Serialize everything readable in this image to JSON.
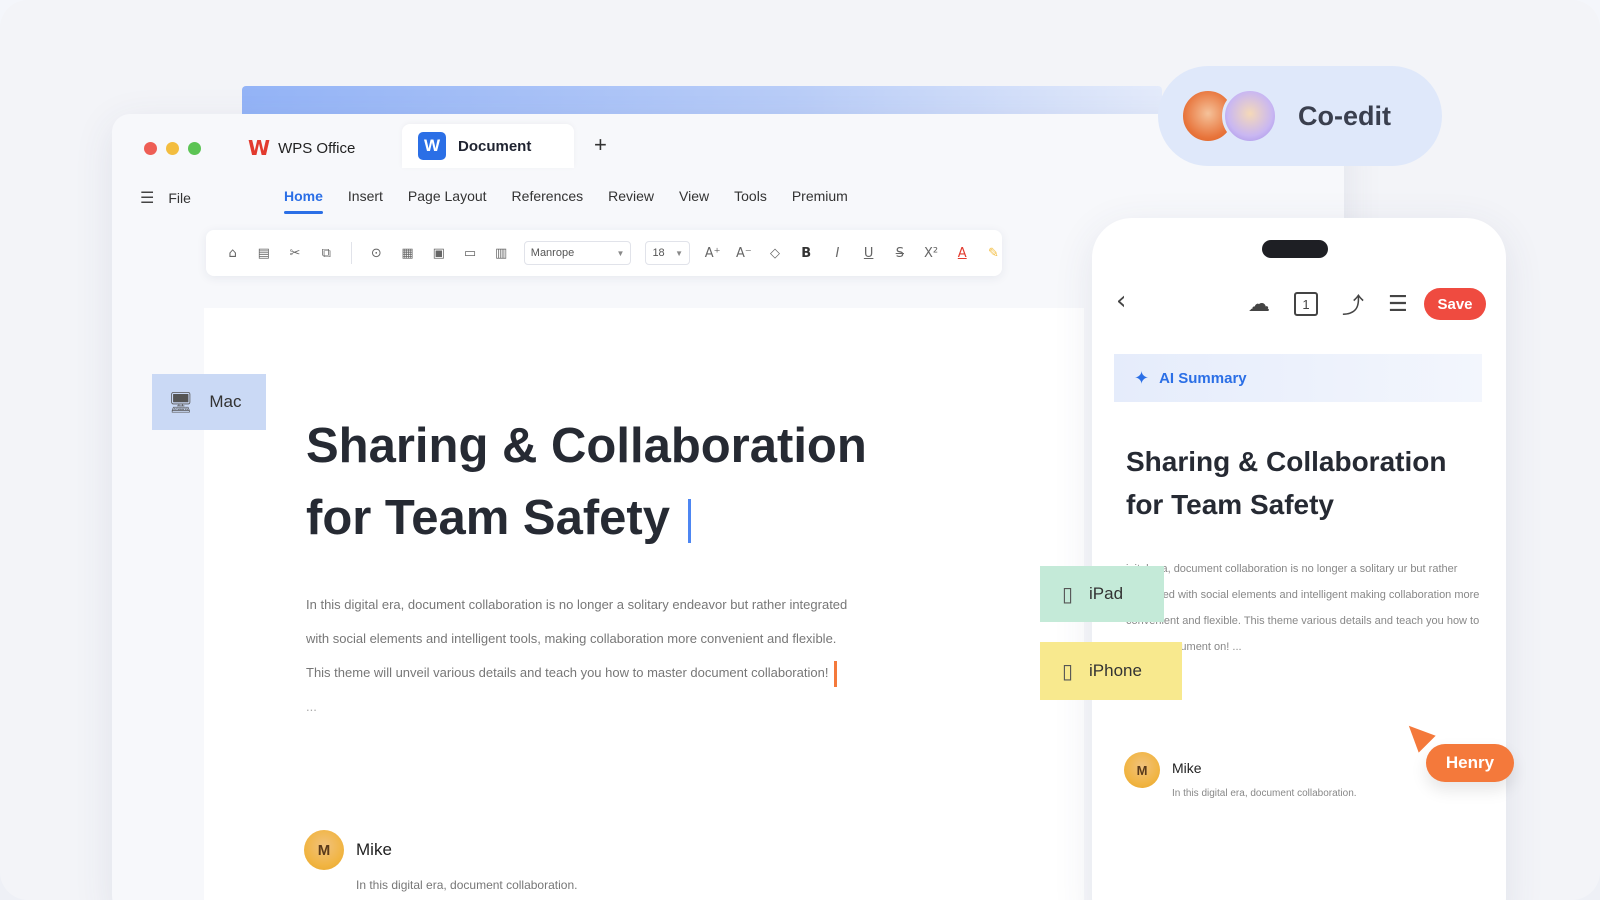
{
  "app": {
    "name": "WPS Office",
    "doc_tab": "Document",
    "new_tab": "+"
  },
  "menu": {
    "file": "File",
    "tabs": [
      "Home",
      "Insert",
      "Page Layout",
      "References",
      "Review",
      "View",
      "Tools",
      "Premium"
    ],
    "active_tab": "Home"
  },
  "toolbar": {
    "font": "Manrope",
    "size": "18"
  },
  "document": {
    "title_line1": "Sharing & Collaboration",
    "title_line2": "for Team Safety",
    "body_line1": "In this digital era, document collaboration is no longer a solitary endeavor but rather integrated",
    "body_line2": "with social elements and intelligent tools, making collaboration more convenient and flexible.",
    "body_line3": "This theme will unveil various details and teach you how to master document collaboration!",
    "ellipsis": "...",
    "comment": {
      "author": "Mike",
      "avatar": "M",
      "text": "In this digital era, document collaboration."
    }
  },
  "devices": {
    "mac": "Mac",
    "ipad": "iPad",
    "iphone": "iPhone"
  },
  "coedit": {
    "label": "Co-edit",
    "avatar1": "",
    "avatar2": ""
  },
  "phone": {
    "save": "Save",
    "page_num": "1",
    "ai_summary": "AI Summary",
    "title_line1": "Sharing & Collaboration",
    "title_line2": "for Team Safety",
    "body": "igital era, document collaboration is no longer a solitary   ur but rather integrated with social elements and intelligent   making collaboration more convenient and flexible. This theme   various details and teach you how to master document   on! ...",
    "comment": {
      "author": "Mike",
      "avatar": "M",
      "text": "In this digital era, document collaboration."
    }
  },
  "cursor_user": "Henry",
  "colors": {
    "accent": "#2b6fe6",
    "save": "#ef4b40",
    "henry": "#f4793b",
    "mac": "#cad9f5",
    "ipad": "#c4ead8",
    "iphone": "#f8e98e"
  }
}
